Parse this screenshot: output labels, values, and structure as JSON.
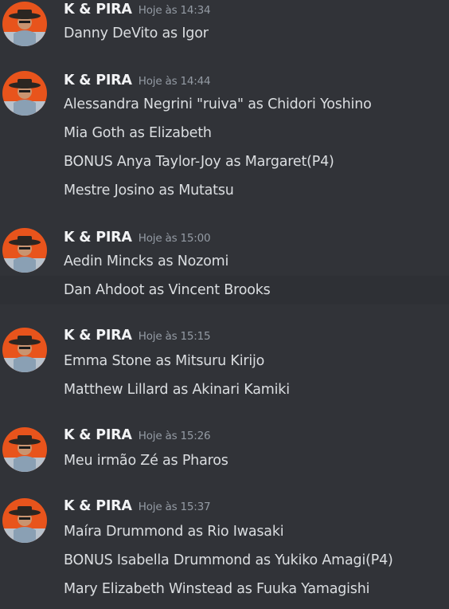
{
  "colors": {
    "background": "#313338",
    "username": "#f2f3f5",
    "timestamp": "#949ba4",
    "message_text": "#dbdee1",
    "avatar_bg": "#e8541c"
  },
  "messages": [
    {
      "author": "K & PIRA",
      "time": "Hoje às 14:34",
      "lines": [
        "Danny DeVito as Igor"
      ]
    },
    {
      "author": "K & PIRA",
      "time": "Hoje às 14:44",
      "lines": [
        "Alessandra Negrini \"ruiva\" as Chidori Yoshino",
        "Mia Goth as Elizabeth",
        "BONUS Anya Taylor-Joy as Margaret(P4)",
        "Mestre Josino as Mutatsu"
      ]
    },
    {
      "author": "K & PIRA",
      "time": "Hoje às 15:00",
      "lines": [
        "Aedin Mincks as Nozomi",
        "Dan Ahdoot as Vincent Brooks"
      ]
    },
    {
      "author": "K & PIRA",
      "time": "Hoje às 15:15",
      "lines": [
        "Emma Stone as Mitsuru Kirijo",
        "Matthew Lillard as Akinari Kamiki"
      ]
    },
    {
      "author": "K & PIRA",
      "time": "Hoje às 15:26",
      "lines": [
        "Meu irmão Zé as Pharos"
      ]
    },
    {
      "author": "K & PIRA",
      "time": "Hoje às 15:37",
      "lines": [
        "Maíra Drummond as Rio Iwasaki",
        "BONUS Isabella Drummond as Yukiko Amagi(P4)",
        "Mary Elizabeth Winstead as Fuuka Yamagishi"
      ]
    }
  ]
}
